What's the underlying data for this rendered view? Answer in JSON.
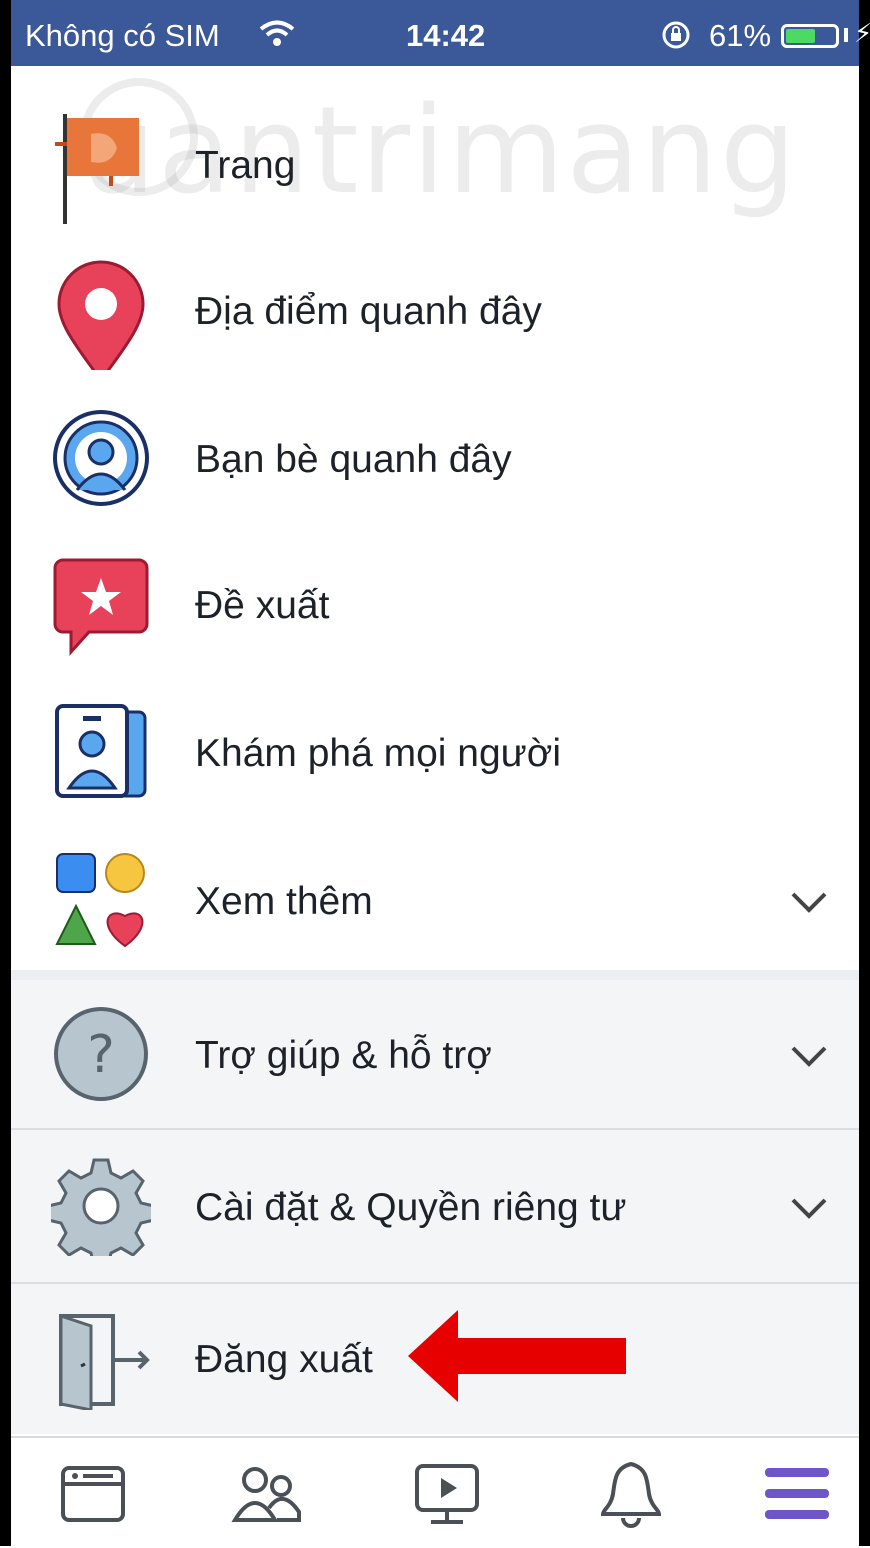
{
  "status_bar": {
    "carrier": "Không có SIM",
    "time": "14:42",
    "battery": "61%",
    "battery_level": 0.61
  },
  "watermark": "uantrimang",
  "menu": {
    "items": [
      {
        "label": "Trang",
        "icon": "flag-icon"
      },
      {
        "label": "Địa điểm quanh đây",
        "icon": "location-pin-icon"
      },
      {
        "label": "Bạn bè quanh đây",
        "icon": "nearby-friends-icon"
      },
      {
        "label": "Đề xuất",
        "icon": "star-speech-bubble-icon"
      },
      {
        "label": "Khám phá mọi người",
        "icon": "people-cards-icon"
      },
      {
        "label": "Xem thêm",
        "icon": "shapes-icon"
      }
    ],
    "sections": [
      {
        "label": "Trợ giúp & hỗ trợ",
        "icon": "question-circle-icon"
      },
      {
        "label": "Cài đặt & Quyền riêng tư",
        "icon": "gear-icon"
      }
    ],
    "logout": {
      "label": "Đăng xuất",
      "icon": "logout-door-icon"
    }
  },
  "tabbar": {
    "tabs": [
      "news-feed-icon",
      "friends-icon",
      "watch-icon",
      "bell-icon",
      "menu-icon"
    ],
    "active_color": "#6e55c9"
  },
  "colors": {
    "brand": "#3b5998",
    "annotation_arrow": "#e60000"
  }
}
